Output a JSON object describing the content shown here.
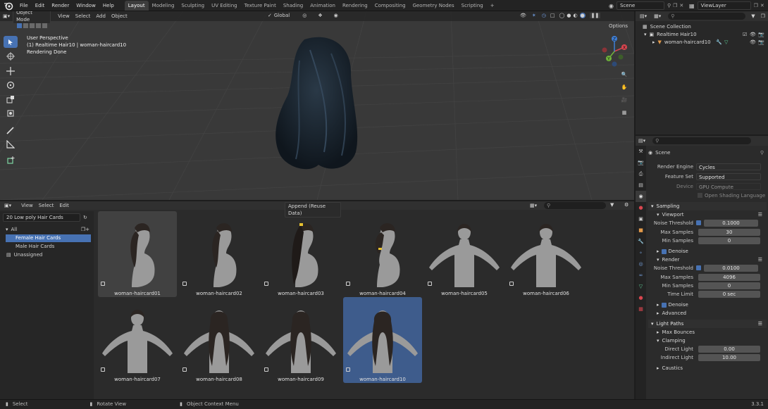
{
  "menu": {
    "items": [
      "File",
      "Edit",
      "Render",
      "Window",
      "Help"
    ],
    "workspaces": [
      "Layout",
      "Modeling",
      "Sculpting",
      "UV Editing",
      "Texture Paint",
      "Shading",
      "Animation",
      "Rendering",
      "Compositing",
      "Geometry Nodes",
      "Scripting"
    ],
    "active_workspace": "Layout",
    "scene": "Scene",
    "view_layer": "ViewLayer"
  },
  "viewport": {
    "mode": "Object Mode",
    "menus": [
      "View",
      "Select",
      "Add",
      "Object"
    ],
    "orientation": "Global",
    "options_label": "Options",
    "info_lines": [
      "User Perspective",
      "(1) Realtime Hair10 | woman-haircard10",
      "Rendering Done"
    ],
    "gizmo_axes": [
      "X",
      "Y",
      "Z"
    ]
  },
  "outliner": {
    "root": "Scene Collection",
    "collection": "Realtime Hair10",
    "object": "woman-haircard10"
  },
  "properties": {
    "context": "Scene",
    "render_engine_label": "Render Engine",
    "render_engine": "Cycles",
    "feature_set_label": "Feature Set",
    "feature_set": "Supported",
    "device_label": "Device",
    "device": "GPU Compute",
    "osl_label": "Open Shading Language",
    "sampling": "Sampling",
    "viewport_panel": "Viewport",
    "noise_threshold_label": "Noise Threshold",
    "viewport_noise": "0.1000",
    "max_samples_label": "Max Samples",
    "viewport_max_samples": "30",
    "min_samples_label": "Min Samples",
    "viewport_min_samples": "0",
    "denoise_label": "Denoise",
    "render_panel": "Render",
    "render_noise": "0.0100",
    "render_max_samples": "4096",
    "render_min_samples": "0",
    "time_limit_label": "Time Limit",
    "time_limit": "0 sec",
    "advanced": "Advanced",
    "light_paths": "Light Paths",
    "max_bounces": "Max Bounces",
    "clamping": "Clamping",
    "direct_light_label": "Direct Light",
    "direct_light": "0.00",
    "indirect_light_label": "Indirect Light",
    "indirect_light": "10.00",
    "caustics": "Caustics"
  },
  "browser": {
    "menus": [
      "View",
      "Select",
      "Edit"
    ],
    "library": "20 Low poly Hair Cards",
    "import_mode": "Append (Reuse Data)",
    "catalogs": [
      "All",
      "Female Hair Cards",
      "Male Hair Cards",
      "Unassigned"
    ],
    "selected_catalog": "Female Hair Cards",
    "assets": [
      "woman-haircard01",
      "woman-haircard02",
      "woman-haircard03",
      "woman-haircard04",
      "woman-haircard05",
      "woman-haircard06",
      "woman-haircard07",
      "woman-haircard08",
      "woman-haircard09",
      "woman-haircard10"
    ],
    "selected_asset": "woman-haircard10"
  },
  "status": {
    "select": "Select",
    "rotate": "Rotate View",
    "context_menu": "Object Context Menu",
    "version": "3.3.1"
  },
  "colors": {
    "accent": "#4772b3",
    "viewport_bg": "#393939",
    "hair": "#1b2530"
  }
}
